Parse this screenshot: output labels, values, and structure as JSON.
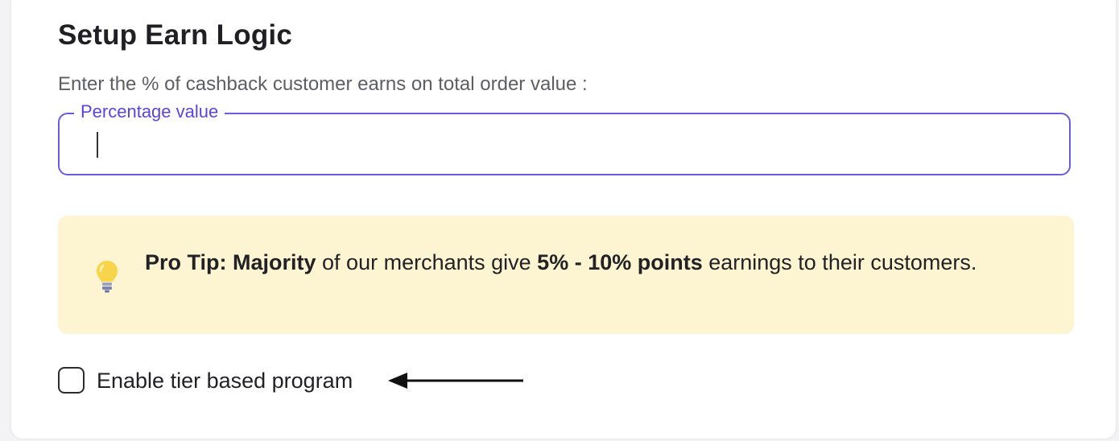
{
  "section": {
    "title": "Setup Earn Logic",
    "subtitle": "Enter the % of cashback customer earns on total order value :"
  },
  "percentage_field": {
    "label": "Percentage value",
    "value": "",
    "accent_color": "#6a5ae0"
  },
  "pro_tip": {
    "icon": "lightbulb-icon",
    "lead": "Pro Tip: Majority",
    "text_before_highlight": " of our merchants give ",
    "highlight": "5% - 10% points",
    "text_after_highlight": " earnings to their customers.",
    "background_color": "#fdf4d2"
  },
  "tier_option": {
    "label": "Enable tier based program",
    "checked": false
  },
  "annotation": {
    "icon": "arrow-left-icon"
  }
}
